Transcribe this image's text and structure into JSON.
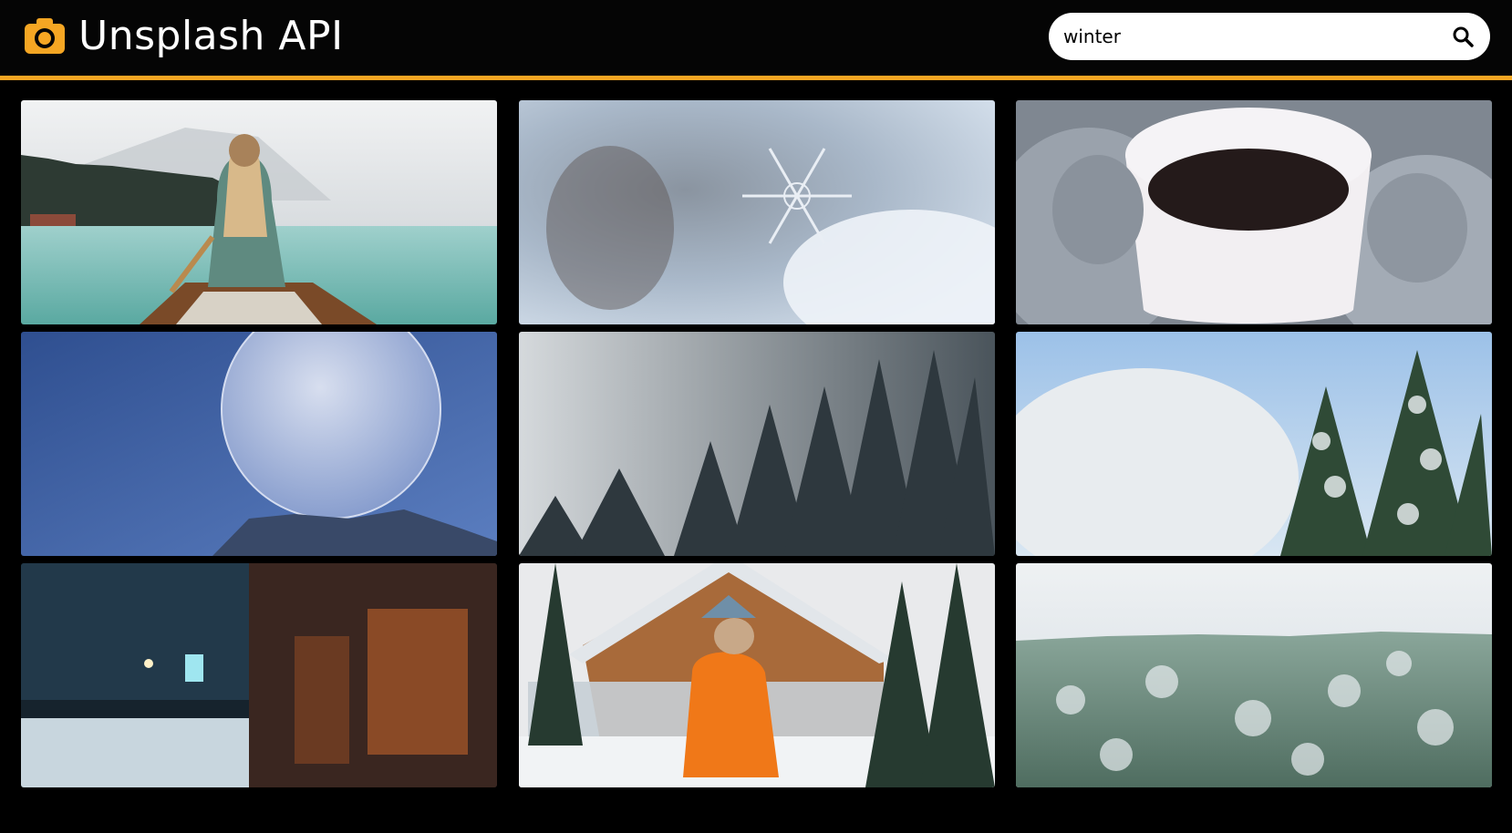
{
  "app": {
    "title": "Unsplash API",
    "logo_icon": "camera-icon",
    "accent_color": "#f5a623"
  },
  "search": {
    "value": "winter",
    "placeholder": "",
    "icon": "search-icon"
  },
  "results": [
    {
      "name": "photo-lake-canoe",
      "colors": [
        "#e6e8ea",
        "#7fc2bd"
      ]
    },
    {
      "name": "photo-snowflake",
      "colors": [
        "#b9c7d6",
        "#6e7d8c"
      ]
    },
    {
      "name": "photo-coffee-mittens",
      "colors": [
        "#8e96a0",
        "#2a2020"
      ]
    },
    {
      "name": "photo-frozen-bubble",
      "colors": [
        "#3f5fa0",
        "#c9d3ec"
      ]
    },
    {
      "name": "photo-foggy-forest",
      "colors": [
        "#c5cad0",
        "#2b343b"
      ]
    },
    {
      "name": "photo-snowy-trees",
      "colors": [
        "#b7d3ee",
        "#2f4a36"
      ]
    },
    {
      "name": "photo-snowy-street-night",
      "colors": [
        "#1e3340",
        "#b06a3a"
      ]
    },
    {
      "name": "photo-cabin-orange-jacket",
      "colors": [
        "#e8e8ea",
        "#f07818"
      ]
    },
    {
      "name": "photo-frosty-forest",
      "colors": [
        "#dfe5ea",
        "#5f7d6c"
      ]
    }
  ]
}
